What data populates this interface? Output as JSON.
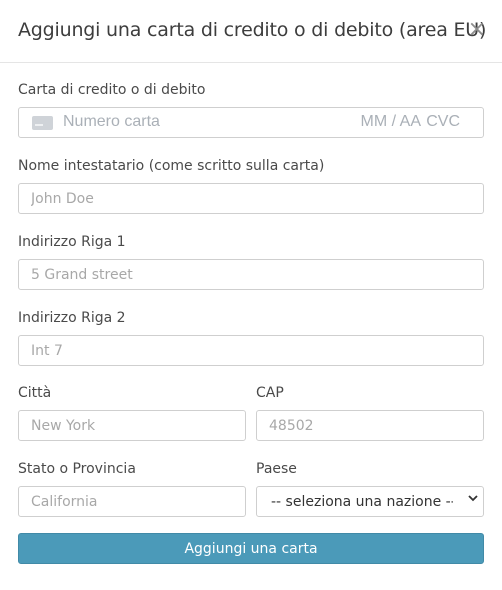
{
  "dialog": {
    "title": "Aggiungi una carta di credito o di debito (area EU)",
    "close_label": "×"
  },
  "card": {
    "label": "Carta di credito o di debito",
    "number_placeholder": "Numero carta",
    "expiry_placeholder": "MM / AA",
    "cvc_placeholder": "CVC",
    "icon": "credit-card-icon"
  },
  "name": {
    "label": "Nome intestatario (come scritto sulla carta)",
    "placeholder": "John Doe"
  },
  "address1": {
    "label": "Indirizzo Riga 1",
    "placeholder": "5 Grand street"
  },
  "address2": {
    "label": "Indirizzo Riga 2",
    "placeholder": "Int 7"
  },
  "city": {
    "label": "Città",
    "placeholder": "New York"
  },
  "zip": {
    "label": "CAP",
    "placeholder": "48502"
  },
  "state": {
    "label": "Stato o Provincia",
    "placeholder": "California"
  },
  "country": {
    "label": "Paese",
    "selected": "-- seleziona una nazione --"
  },
  "submit": {
    "label": "Aggiungi una carta",
    "color": "#4b9ab9"
  }
}
